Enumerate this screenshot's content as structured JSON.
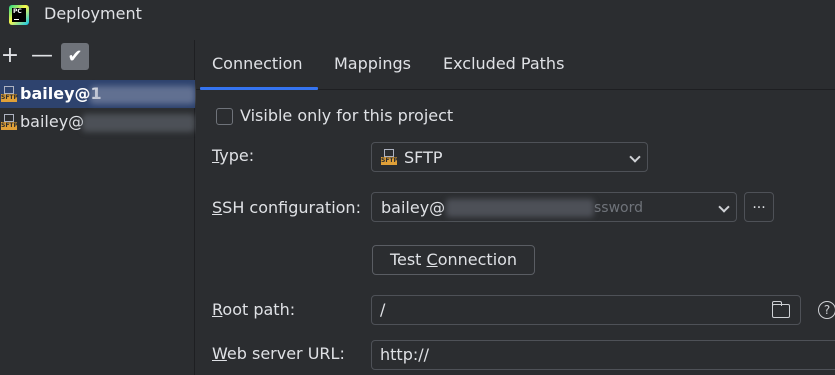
{
  "window": {
    "title": "Deployment",
    "app_icon_text": "PC"
  },
  "toolbar": {
    "add_label": "+",
    "remove_label": "—",
    "apply_label": "✔"
  },
  "servers": [
    {
      "label": "bailey@1",
      "selected": true,
      "icon": "sftp-icon",
      "icon_text": "SFTP"
    },
    {
      "label": "bailey@",
      "selected": false,
      "icon": "sftp-icon",
      "icon_text": "SFTP"
    }
  ],
  "tabs": [
    {
      "label": "Connection",
      "active": true
    },
    {
      "label": "Mappings",
      "active": false
    },
    {
      "label": "Excluded Paths",
      "active": false
    }
  ],
  "form": {
    "visible_only_label": "Visible only for this project",
    "visible_only_checked": false,
    "type_label_prefix": "T",
    "type_label_rest": "ype:",
    "type_value": "SFTP",
    "type_icon_text": "SFTP",
    "ssh_label_prefix": "S",
    "ssh_label_rest": "SH configuration:",
    "ssh_value": "bailey@",
    "ssh_suffix": "ssword",
    "ssh_more_label": "...",
    "test_label_before": "Test ",
    "test_label_underlined": "C",
    "test_label_after": "onnection",
    "root_label_prefix": "R",
    "root_label_rest": "oot path:",
    "root_value": "/",
    "url_label_prefix": "W",
    "url_label_rest": "eb server URL:",
    "url_value": "http://",
    "help_label": "?"
  },
  "colors": {
    "background": "#2b2d30",
    "selection": "#2e436e",
    "accent": "#3574f0",
    "border": "#4e5157"
  }
}
